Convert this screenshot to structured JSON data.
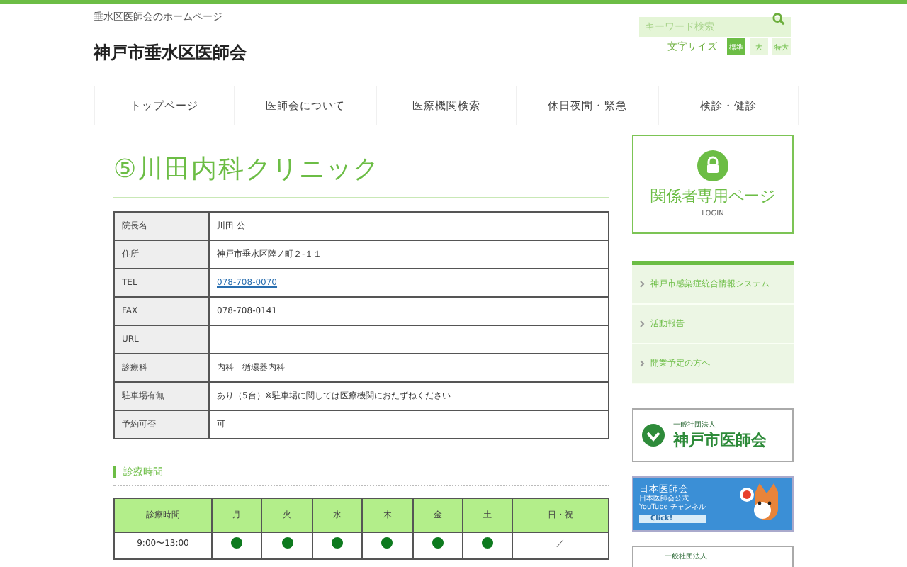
{
  "header": {
    "tagline": "垂水区医師会のホームページ",
    "site_title": "神戸市垂水区医師会",
    "search": {
      "placeholder": "キーワード検索"
    },
    "font_size": {
      "label": "文字サイズ",
      "options": [
        {
          "label": "標準",
          "selected": true
        },
        {
          "label": "大",
          "selected": false
        },
        {
          "label": "特大",
          "selected": false
        }
      ]
    }
  },
  "nav": [
    "トップページ",
    "医師会について",
    "医療機関検索",
    "休日夜間・緊急",
    "検診・健診"
  ],
  "page_title": "⑤川田内科クリニック",
  "info_table": [
    {
      "label": "院長名",
      "value": "川田 公一",
      "kind": "text"
    },
    {
      "label": "住所",
      "value": "神戸市垂水区陸ノ町２-１１",
      "kind": "text"
    },
    {
      "label": "TEL",
      "value": "078-708-0070",
      "kind": "link"
    },
    {
      "label": "FAX",
      "value": "078-708-0141",
      "kind": "text"
    },
    {
      "label": "URL",
      "kind": "text"
    },
    {
      "label": "診療科",
      "value": "内科　循環器内科",
      "kind": "text"
    },
    {
      "label": "駐車場有無",
      "value": "あり（5台）※駐車場に関しては医療機関におたずねください",
      "kind": "text"
    },
    {
      "label": "予約可否",
      "value": "可",
      "kind": "text"
    }
  ],
  "hours": {
    "heading": "診療時間",
    "columns": [
      "診療時間",
      "月",
      "火",
      "水",
      "木",
      "金",
      "土",
      "日・祝"
    ],
    "rows": [
      {
        "time": "9:00〜13:00",
        "days": [
          {
            "open": true
          },
          {
            "open": true
          },
          {
            "open": true
          },
          {
            "open": true
          },
          {
            "open": true
          },
          {
            "open": true
          },
          {
            "open": false,
            "text": "／"
          }
        ]
      }
    ]
  },
  "sidebar": {
    "login": {
      "title": "関係者専用ページ",
      "subtitle": "LOGIN"
    },
    "links": [
      "神戸市感染症統合情報システム",
      "活動報告",
      "開業予定の方へ"
    ],
    "banners": [
      {
        "kind": "kobe",
        "small": "一般社団法人",
        "big": "神戸市医師会"
      },
      {
        "kind": "youtube",
        "small": "日本医師会",
        "line1": "日本医師会公式",
        "line2": "YouTube チャンネル",
        "button": "Click!"
      },
      {
        "kind": "hyogo",
        "small": "一般社団法人"
      }
    ]
  }
}
